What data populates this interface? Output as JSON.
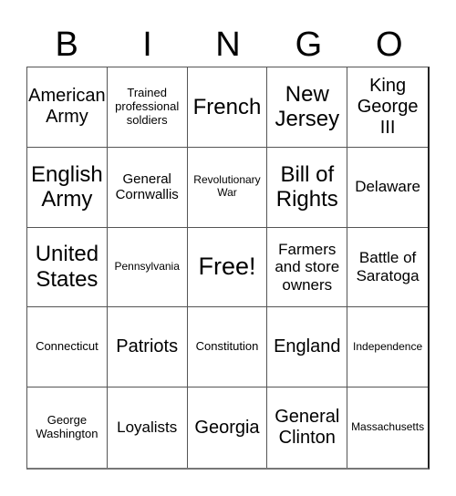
{
  "header": {
    "letters": [
      "B",
      "I",
      "N",
      "G",
      "O"
    ]
  },
  "cells": [
    {
      "text": "American Army"
    },
    {
      "text": "Trained professional soldiers"
    },
    {
      "text": "French"
    },
    {
      "text": "New Jersey"
    },
    {
      "text": "King George III"
    },
    {
      "text": "English Army"
    },
    {
      "text": "General Cornwallis"
    },
    {
      "text": "Revolutionary War"
    },
    {
      "text": "Bill of Rights"
    },
    {
      "text": "Delaware"
    },
    {
      "text": "United States"
    },
    {
      "text": "Pennsylvania"
    },
    {
      "text": "Free!"
    },
    {
      "text": "Farmers and store owners"
    },
    {
      "text": "Battle of Saratoga"
    },
    {
      "text": "Connecticut"
    },
    {
      "text": "Patriots"
    },
    {
      "text": "Constitution"
    },
    {
      "text": "England"
    },
    {
      "text": "Independence"
    },
    {
      "text": "George Washington"
    },
    {
      "text": "Loyalists"
    },
    {
      "text": "Georgia"
    },
    {
      "text": "General Clinton"
    },
    {
      "text": "Massachusetts"
    }
  ]
}
